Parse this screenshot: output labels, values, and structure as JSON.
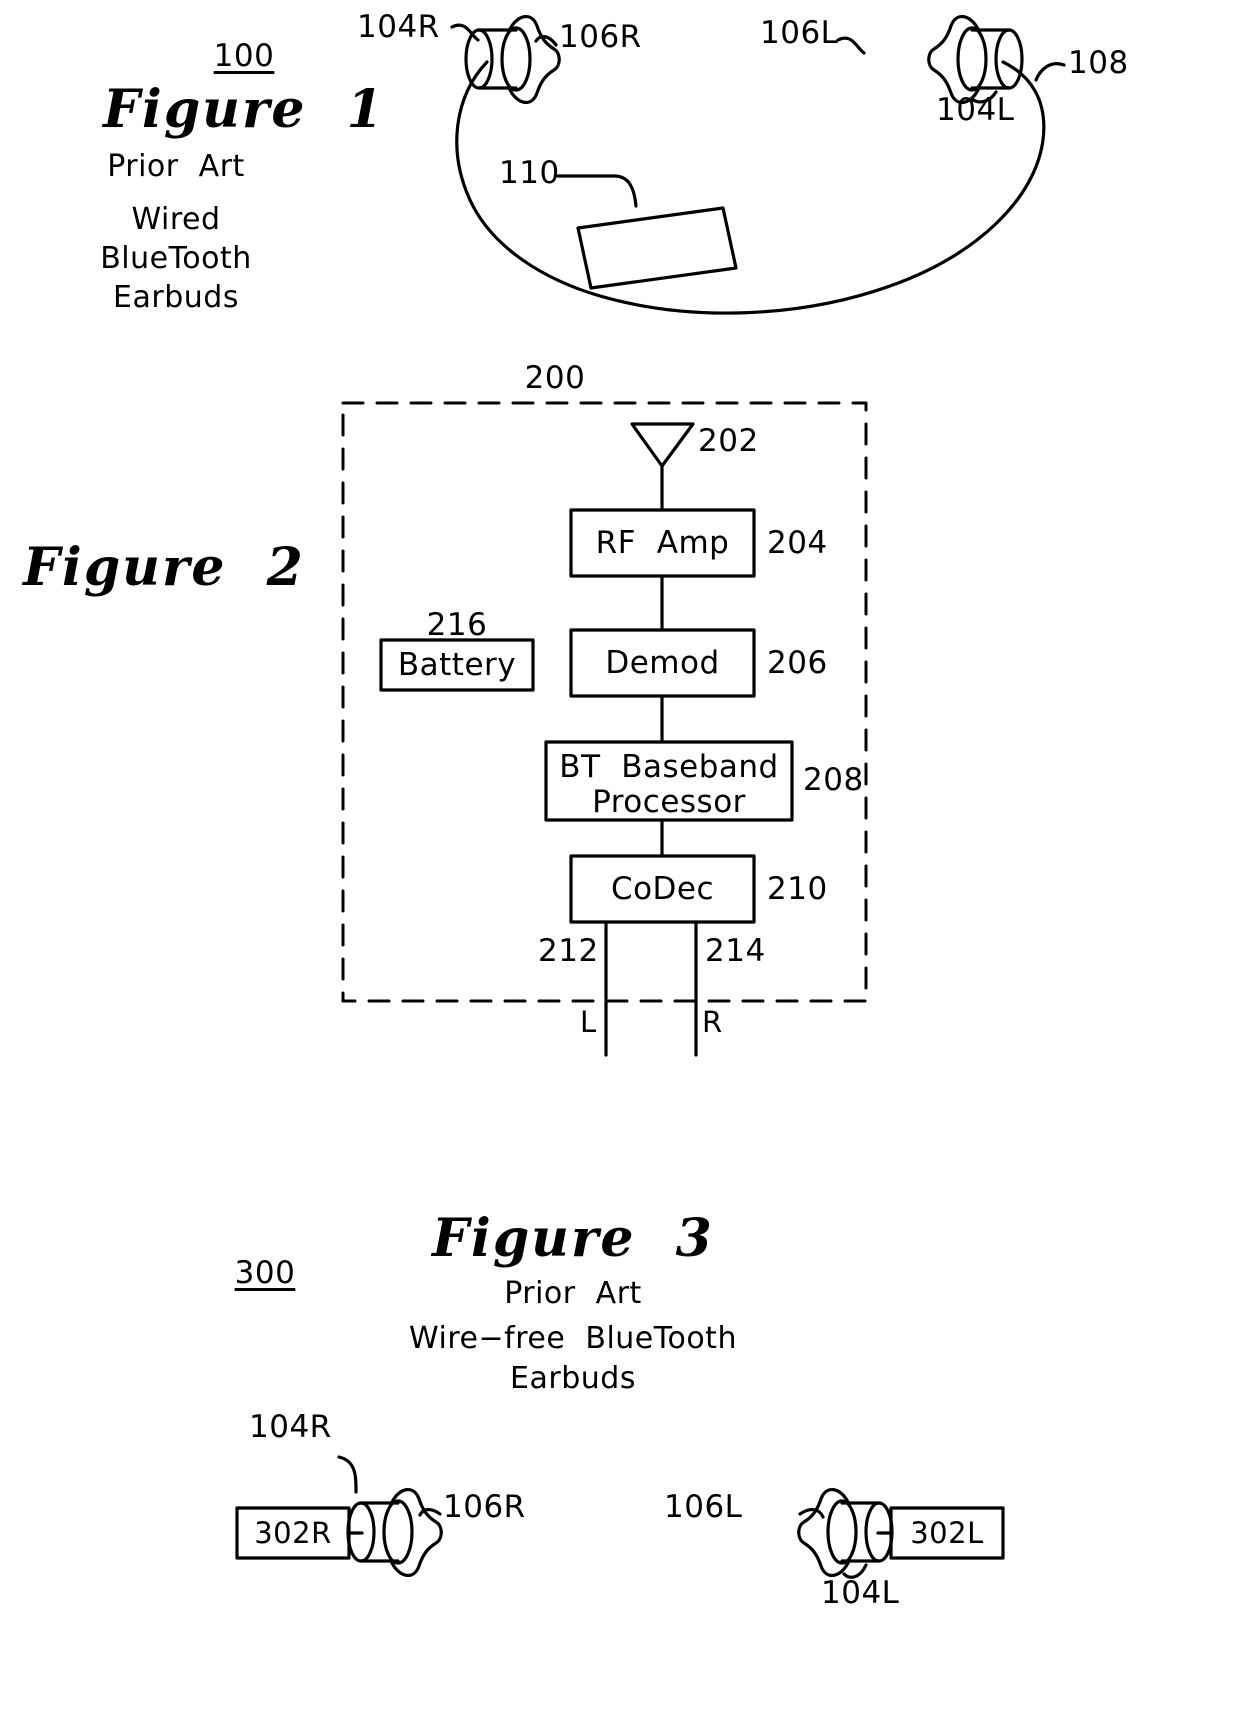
{
  "document": {
    "kind": "patent-drawing-sheet",
    "figures": [
      {
        "id": "figure-1",
        "ref": "100",
        "title": "Figure  1",
        "caption_lines": [
          "Prior  Art",
          "Wired",
          "BlueTooth",
          "Earbuds"
        ],
        "callouts": [
          {
            "text": "104R"
          },
          {
            "text": "106R"
          },
          {
            "text": "106L"
          },
          {
            "text": "104L"
          },
          {
            "text": "108"
          },
          {
            "text": "110"
          }
        ]
      },
      {
        "id": "figure-2",
        "ref": "200",
        "title": "Figure  2",
        "blocks": [
          {
            "ref": "202",
            "label": "",
            "kind": "antenna"
          },
          {
            "ref": "204",
            "label": "RF  Amp"
          },
          {
            "ref": "206",
            "label": "Demod"
          },
          {
            "ref": "208",
            "label": "BT  Baseband",
            "label2": "Processor"
          },
          {
            "ref": "210",
            "label": "CoDec"
          },
          {
            "ref": "216",
            "label": "Battery"
          }
        ],
        "outputs": [
          {
            "ref": "212",
            "channel": "L"
          },
          {
            "ref": "214",
            "channel": "R"
          }
        ]
      },
      {
        "id": "figure-3",
        "ref": "300",
        "title": "Figure  3",
        "caption_lines": [
          "Prior  Art",
          "Wire−free  BlueTooth",
          "Earbuds"
        ],
        "callouts": [
          {
            "text": "104R"
          },
          {
            "text": "106R"
          },
          {
            "text": "302R"
          },
          {
            "text": "106L"
          },
          {
            "text": "104L"
          },
          {
            "text": "302L"
          }
        ]
      }
    ]
  },
  "fig1": {
    "ref": "100",
    "title": "Figure  1",
    "cap1": "Prior  Art",
    "cap2": "Wired",
    "cap3": "BlueTooth",
    "cap4": "Earbuds",
    "c_104r": "104R",
    "c_106r": "106R",
    "c_106l": "106L",
    "c_104l": "104L",
    "c_108": "108",
    "c_110": "110"
  },
  "fig2": {
    "title": "Figure  2",
    "ref_200": "200",
    "ref_202": "202",
    "ref_204": "204",
    "ref_206": "206",
    "ref_208": "208",
    "ref_210": "210",
    "ref_212": "212",
    "ref_214": "214",
    "ref_216": "216",
    "blk_rfamp": "RF  Amp",
    "blk_demod": "Demod",
    "blk_bt_l1": "BT  Baseband",
    "blk_bt_l2": "Processor",
    "blk_codec": "CoDec",
    "blk_battery": "Battery",
    "ch_l": "L",
    "ch_r": "R"
  },
  "fig3": {
    "ref": "300",
    "title": "Figure  3",
    "cap1": "Prior  Art",
    "cap2": "Wire−free  BlueTooth",
    "cap3": "Earbuds",
    "c_104r": "104R",
    "c_106r": "106R",
    "c_302r": "302R",
    "c_106l": "106L",
    "c_104l": "104L",
    "c_302l": "302L"
  },
  "colors": {
    "ink": "#000000",
    "paper": "#ffffff"
  }
}
